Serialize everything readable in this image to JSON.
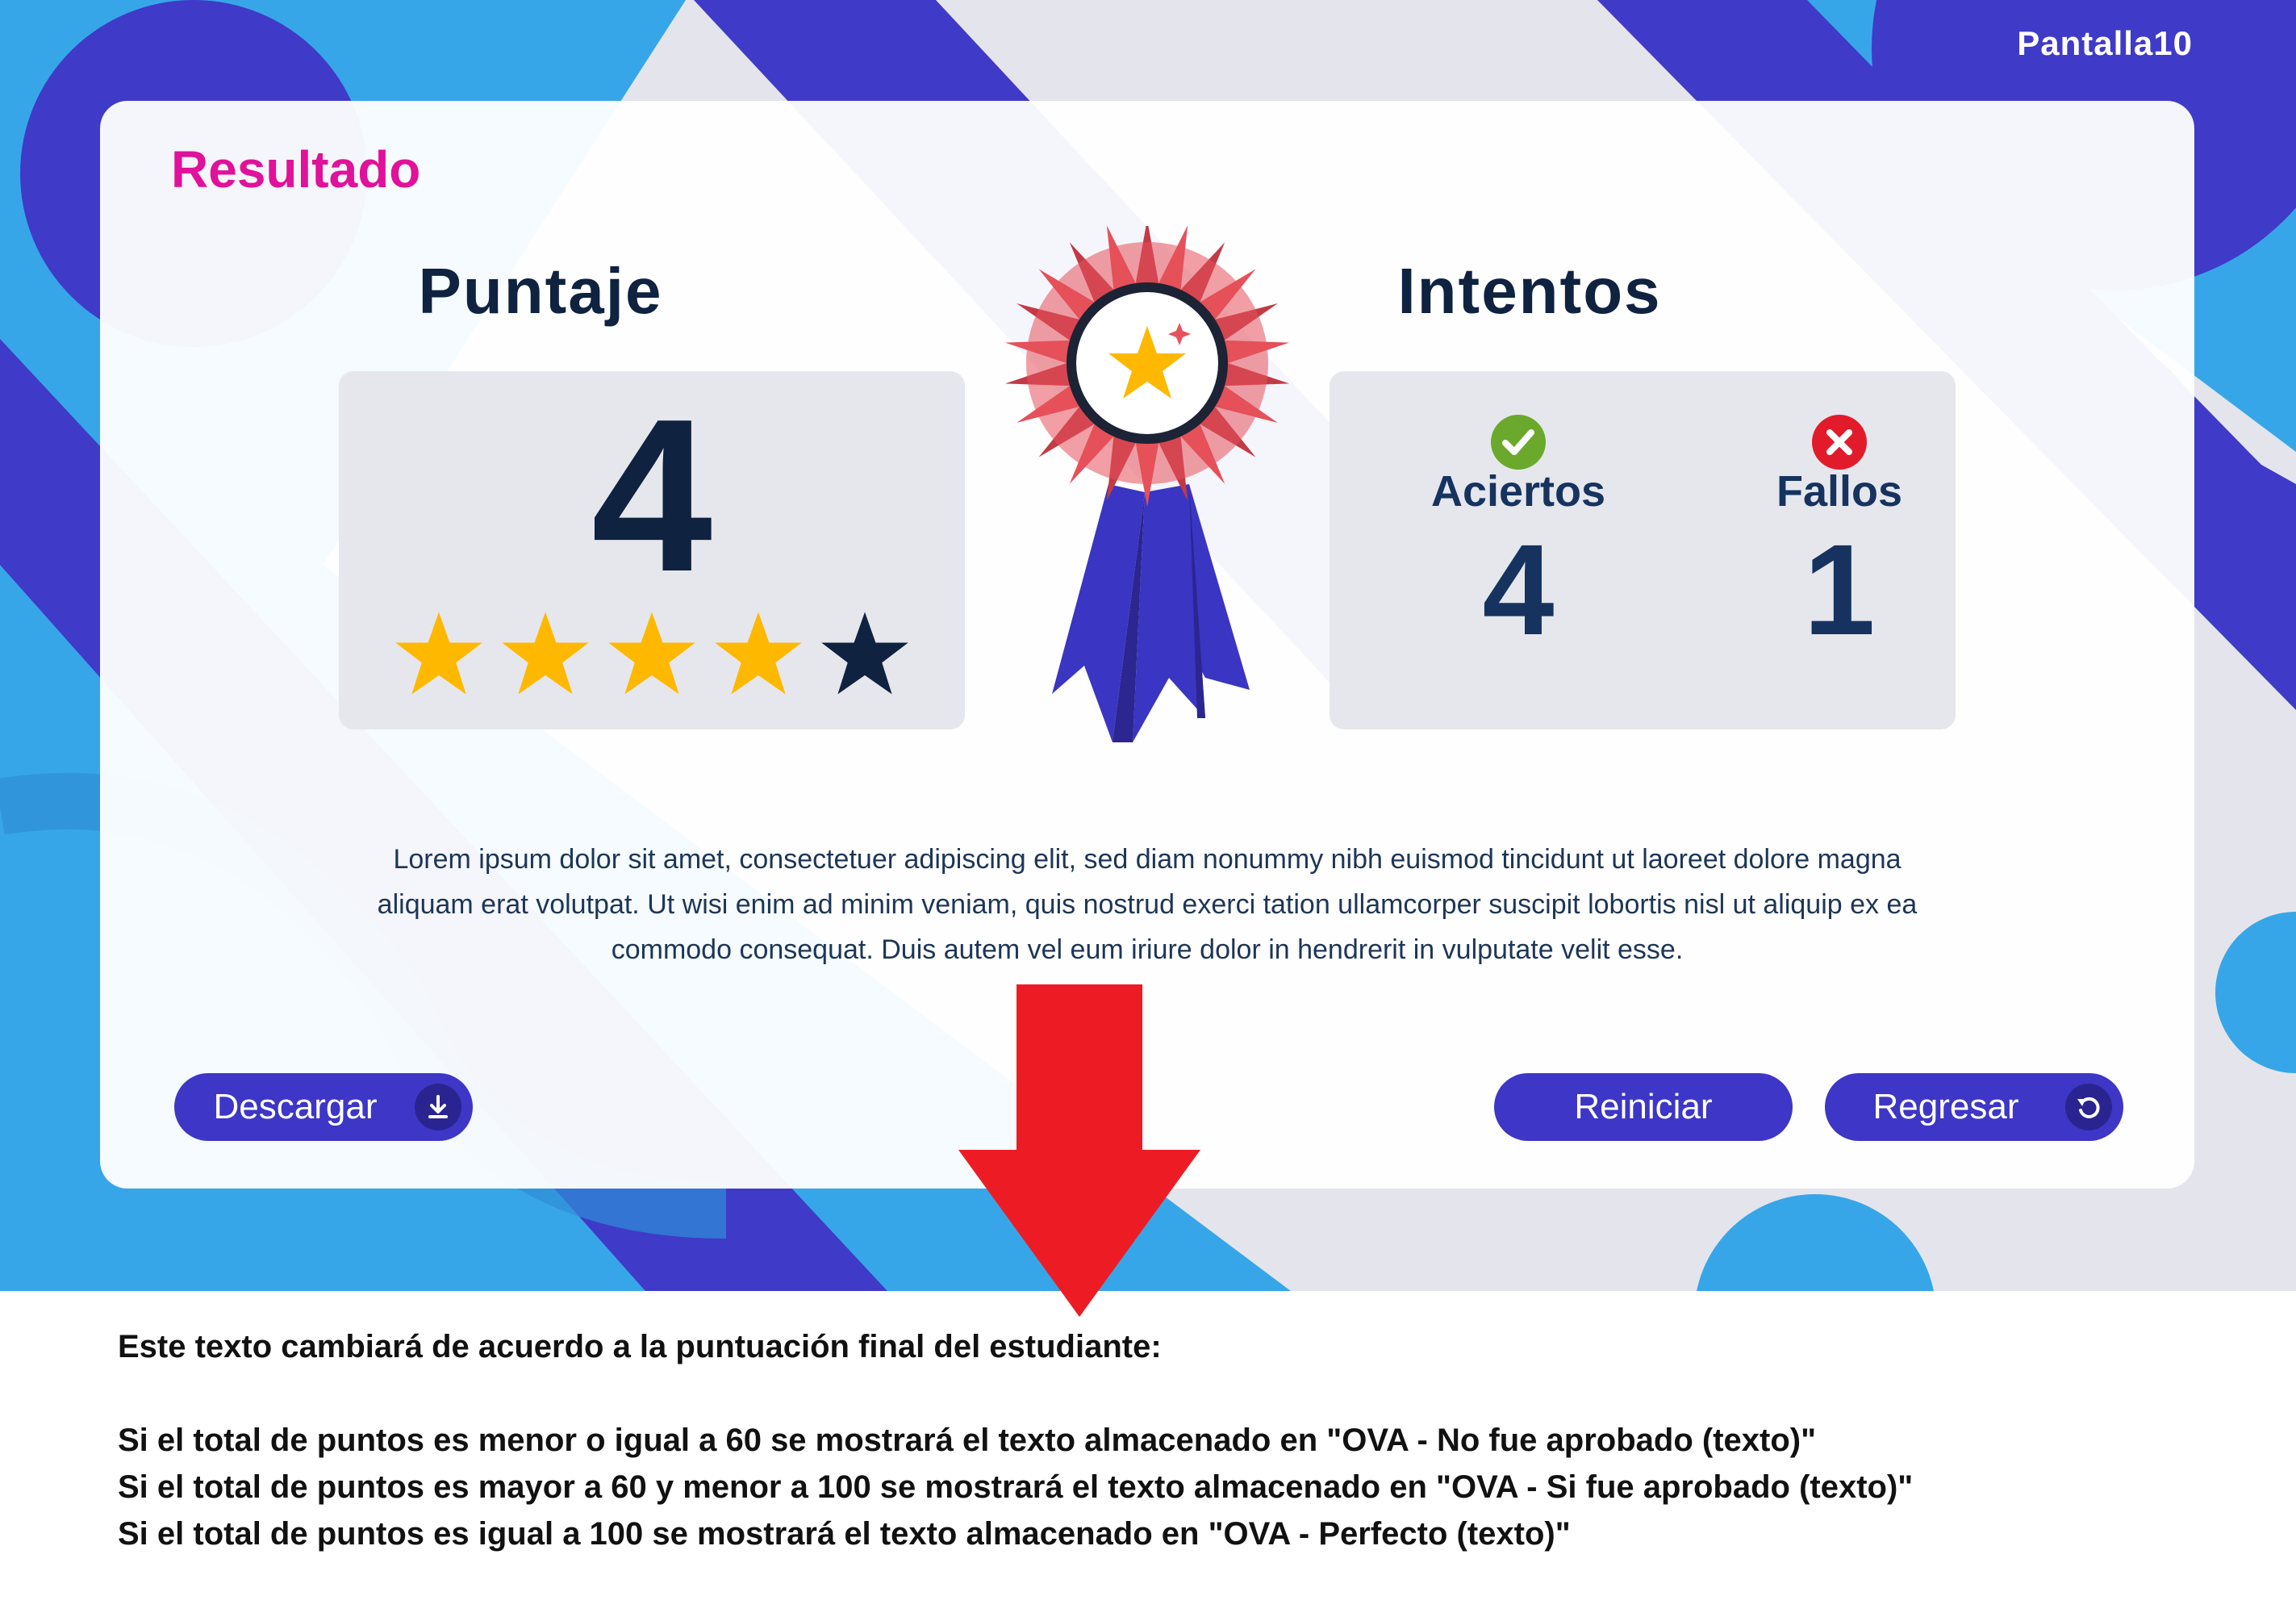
{
  "screen_label": "Pantalla10",
  "result": {
    "title": "Resultado",
    "score": {
      "title": "Puntaje",
      "value": "4",
      "stars_total": 5,
      "stars_filled": 4
    },
    "attempts": {
      "title": "Intentos",
      "hits_label": "Aciertos",
      "hits_value": "4",
      "fails_label": "Fallos",
      "fails_value": "1"
    },
    "description": "Lorem ipsum dolor sit amet, consectetuer adipiscing elit, sed diam nonummy nibh euismod tincidunt ut laoreet dolore magna aliquam erat volutpat. Ut wisi enim ad minim veniam, quis nostrud exerci tation ullamcorper suscipit lobortis nisl ut aliquip ex ea commodo consequat. Duis autem vel eum iriure dolor in hendrerit in vulputate velit esse.",
    "buttons": {
      "download": "Descargar",
      "restart": "Reiniciar",
      "back": "Regresar"
    }
  },
  "notes": {
    "intro": "Este texto cambiará de acuerdo a la puntuación final del estudiante:",
    "rule1": "Si el total de puntos es menor o igual a 60 se mostrará el texto almacenado en \"OVA - No fue aprobado (texto)\"",
    "rule2": "Si el total de puntos es mayor a 60 y menor a 100 se mostrará el texto almacenado en \"OVA - Si fue aprobado (texto)\"",
    "rule3": "Si el total de puntos es igual a 100 se mostrará el texto almacenado en \"OVA - Perfecto (texto)\""
  },
  "icons": {
    "rosette": "award-rosette-icon",
    "hits": "check-circle-icon",
    "fails": "x-circle-icon",
    "download": "download-icon",
    "back": "undo-icon",
    "arrow": "arrow-down-icon"
  },
  "colors": {
    "title": "#e0119a",
    "primary": "#3d36c6",
    "dark_text": "#0f2240",
    "star_filled": "#ffb800",
    "star_empty": "#0f2240",
    "hit": "#6aa92c",
    "fail": "#e21b2b",
    "arrow": "#ed1c24",
    "bg_blue": "#37a6e8",
    "bg_indigo": "#3f3ac8"
  }
}
